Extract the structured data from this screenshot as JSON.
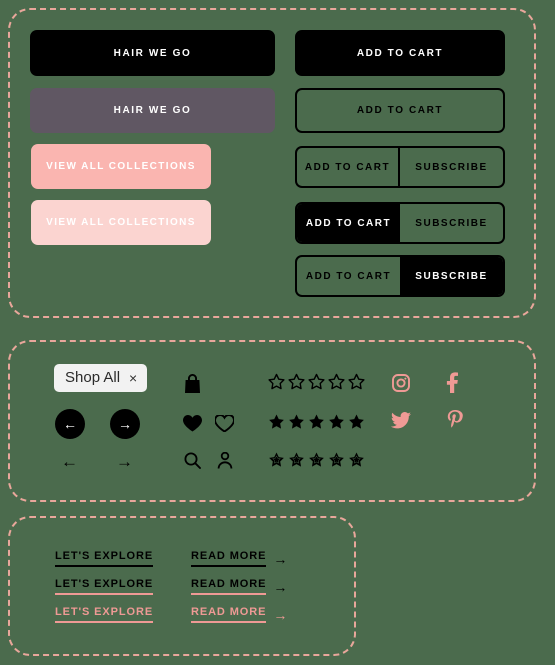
{
  "theme": {
    "background": "#4b6b4d",
    "panel_border": "#e9a79b",
    "accent_pink": "#ef9a95",
    "pink_dark": "#fab5b0",
    "pink_light": "#fbd4d0",
    "black": "#000000",
    "hover_grey": "#605763",
    "chip_bg": "#f2f2f2"
  },
  "buttons_panel": {
    "hair_we_go_solid": "HAIR WE GO",
    "hair_we_go_hover": "HAIR WE GO",
    "view_all_dark": "VIEW ALL COLLECTIONS",
    "view_all_light": "VIEW ALL COLLECTIONS",
    "add_to_cart_solid": "ADD TO CART",
    "add_to_cart_outline": "ADD TO CART",
    "split_buttons": [
      {
        "primary": "ADD TO CART",
        "secondary": "SUBSCRIBE",
        "variant": "outline"
      },
      {
        "primary": "ADD TO CART",
        "secondary": "SUBSCRIBE",
        "variant": "primary-filled"
      },
      {
        "primary": "ADD TO CART",
        "secondary": "SUBSCRIBE",
        "variant": "secondary-filled"
      }
    ]
  },
  "icons_panel": {
    "chip": {
      "label": "Shop All",
      "close": "×"
    },
    "carousel": {
      "circle_prev": "←",
      "circle_next": "→",
      "plain_prev": "←",
      "plain_next": "→"
    },
    "utility_icons": [
      "bag-icon",
      "heart-filled-icon",
      "heart-outline-icon",
      "search-icon",
      "user-icon"
    ],
    "ratings": [
      {
        "style": "outline",
        "filled": 0,
        "total": 5
      },
      {
        "style": "filled",
        "filled": 5,
        "total": 5
      },
      {
        "style": "half",
        "filled": 5,
        "total": 5
      }
    ],
    "social": [
      "instagram-icon",
      "facebook-icon",
      "twitter-icon",
      "pinterest-icon"
    ]
  },
  "links_panel": {
    "explore_label": "LET'S EXPLORE",
    "read_more_label": "READ MORE",
    "arrow": "→",
    "variants": [
      "black-text-black-underline",
      "black-text-pink-underline",
      "pink-text-pink-underline"
    ]
  }
}
